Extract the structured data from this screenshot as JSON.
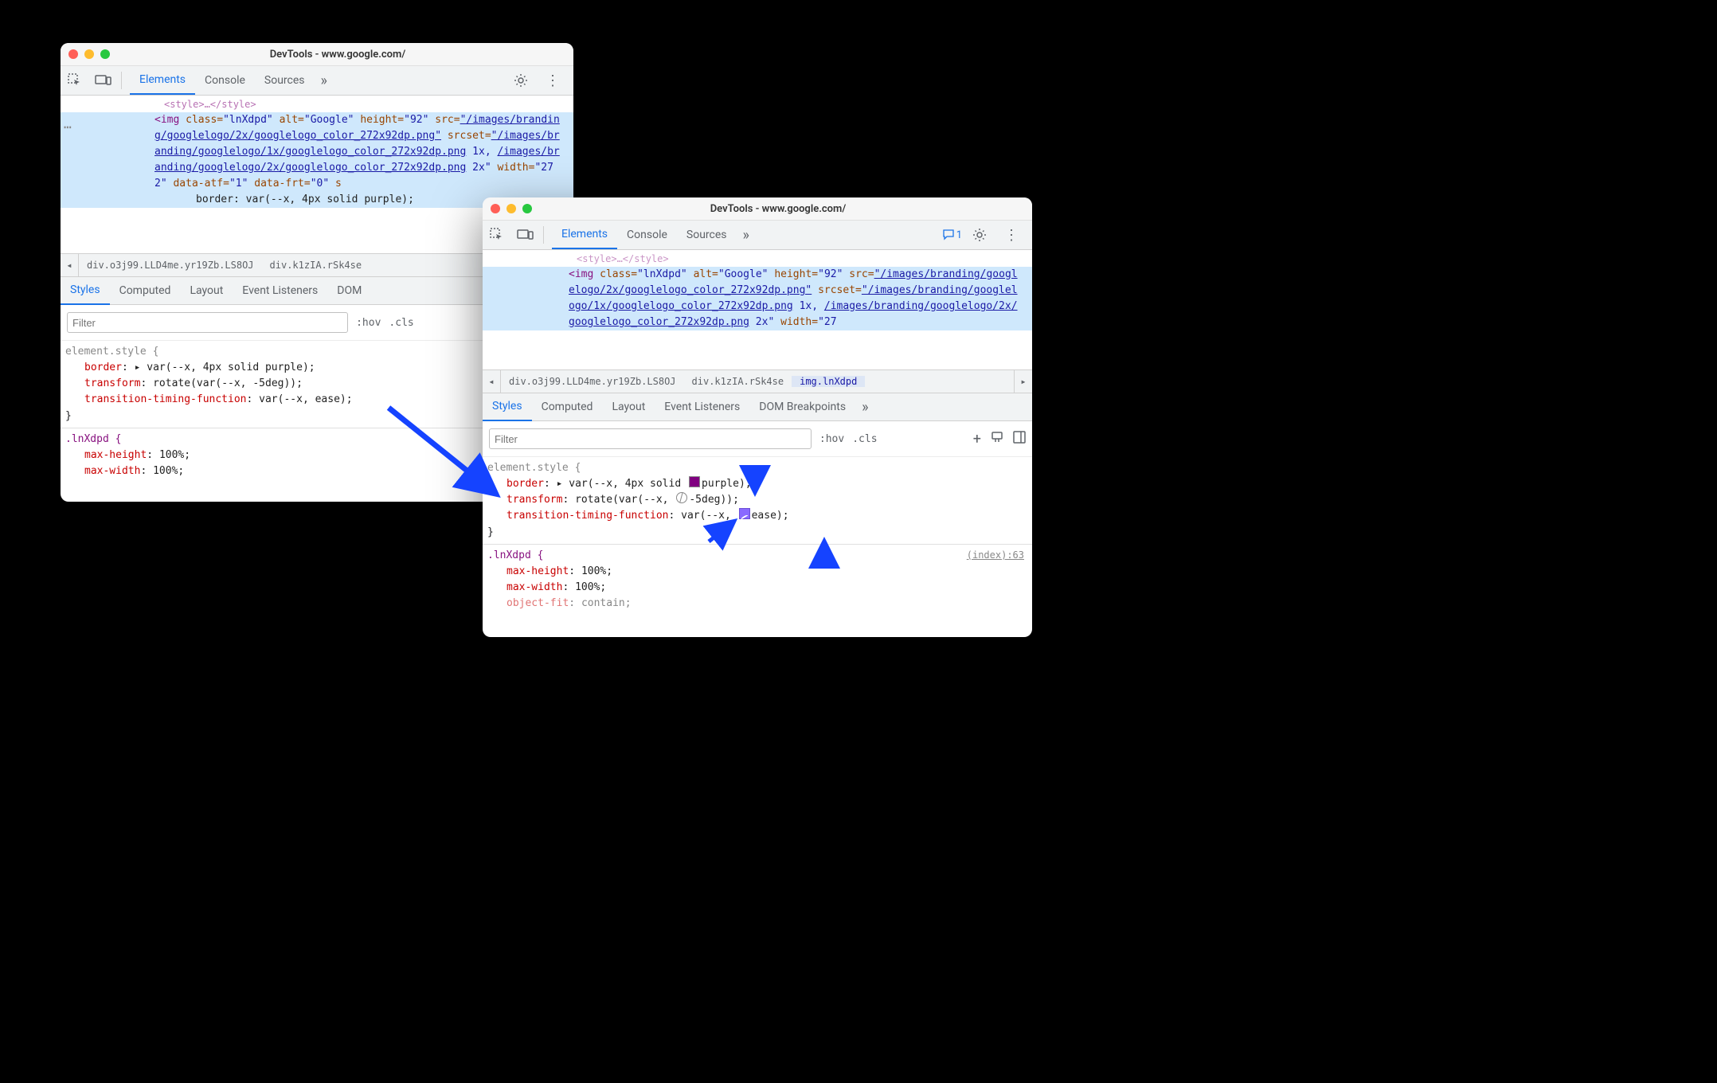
{
  "title": "DevTools - www.google.com/",
  "main_tabs": {
    "elements": "Elements",
    "console": "Console",
    "sources": "Sources",
    "more": "»"
  },
  "msg_count": "1",
  "dom": {
    "style_close": "<style>…</style>",
    "img_open_1": "<img",
    "class_attr": "class=",
    "class_val": "\"lnXdpd\"",
    "alt_attr": "alt=",
    "alt_val": "\"Google\"",
    "height_attr": "height=",
    "height_val": "\"92\"",
    "src_attr": "src=",
    "src_link": "\"/images/branding/googlelogo/2x/googlelogo_color_272x92dp.png\"",
    "srcset_attr": "srcset=",
    "srcset_link1": "\"/images/branding/googlelogo/1x/googlelogo_color_272x92dp.png",
    "srcset_1x": " 1x, ",
    "srcset_link2": "/images/branding/googlelogo/2x/googlelogo_color_272x92dp.png",
    "srcset_2x_close_left": " 2x\"",
    "width_attr": "width=",
    "width_val": "\"272\"",
    "data_atf_attr": "data-atf=",
    "data_atf_val": "\"1\"",
    "data_frt_attr": "data-frt=",
    "data_frt_val": "\"0\"",
    "style_attr_trail": " s",
    "inline_css_left": "border: var(--x, 4px solid purple);",
    "width_val_right": "\"27",
    "src_link_right": "\"/images/branding/googlelogo/2x/googlelogo_color_272x92dp.png\""
  },
  "breadcrumb": {
    "prev": "◂",
    "item1": "div.o3j99.LLD4me.yr19Zb.LS8OJ",
    "item2": "div.k1zIA.rSk4se",
    "item3": "img.lnXdpd",
    "next": "▸"
  },
  "subtabs": {
    "styles": "Styles",
    "computed": "Computed",
    "layout": "Layout",
    "listeners": "Event Listeners",
    "dombp": "DOM Breakpoints",
    "more": "»",
    "dom_short": "DOM "
  },
  "filter": {
    "placeholder": "Filter",
    "hov": ":hov",
    "cls": ".cls"
  },
  "styles_pane": {
    "element_style": "element.style {",
    "border_name": "border",
    "border_val_left": "▸ var(--x, 4px solid purple);",
    "border_val_pre": "▸ var(--x, 4px solid ",
    "border_val_post": "purple);",
    "transform_name": "transform",
    "transform_val_left": "rotate(var(--x, -5deg));",
    "transform_val_pre": "rotate(var(--x, ",
    "transform_val_post": "-5deg));",
    "ttf_name": "transition-timing-function",
    "ttf_val_left": "var(--x, ease);",
    "ttf_val_pre": "var(--x, ",
    "ttf_val_post": "ease);",
    "close": "}",
    "lnxdpd_sel": ".lnXdpd {",
    "maxh_name": "max-height",
    "maxh_val": "100%;",
    "maxw_name": "max-width",
    "maxw_val": "100%;",
    "objfit_name": "object-fit",
    "objfit_val": "contain;",
    "index_link": "(index):63"
  }
}
